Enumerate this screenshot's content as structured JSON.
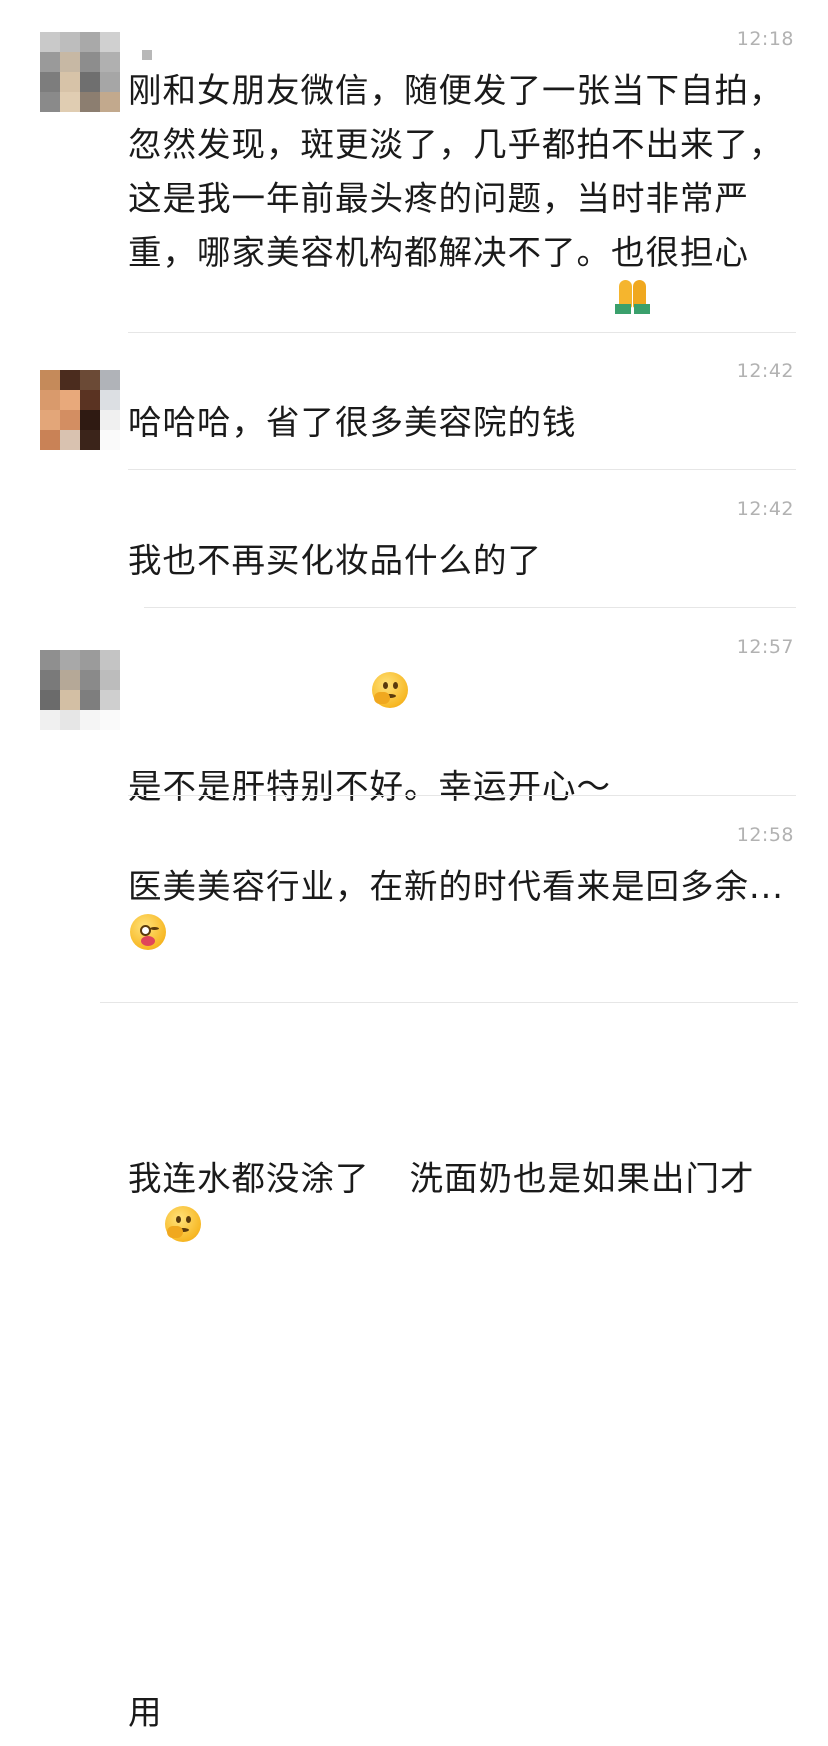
{
  "messages": [
    {
      "time": "12:18",
      "text": "刚和女朋友微信，随便发了一张当下自拍，\n忽然发现，斑更淡了，几乎都拍不出来了，\n这是我一年前最头疼的问题，当时非常严\n重，哪家美容机构都解决不了。也很担心\n是不是肝特别不好。幸运开心～",
      "trailing_emoji": "folded-hands-emoji"
    },
    {
      "time": "12:42",
      "text": "哈哈哈，省了很多美容院的钱"
    },
    {
      "time": "12:42",
      "text": "我也不再买化妆品什么的了"
    },
    {
      "time": "12:57",
      "text_part1": "我连水都没涂了",
      "text_part2": "洗面奶也是如果出门才\n用",
      "emoji": "thinking-face-emoji"
    },
    {
      "time": "12:58",
      "text": "医美美容行业，在新的时代看来是回多余...\n",
      "trailing_emoji": "winking-tongue-emoji"
    }
  ]
}
